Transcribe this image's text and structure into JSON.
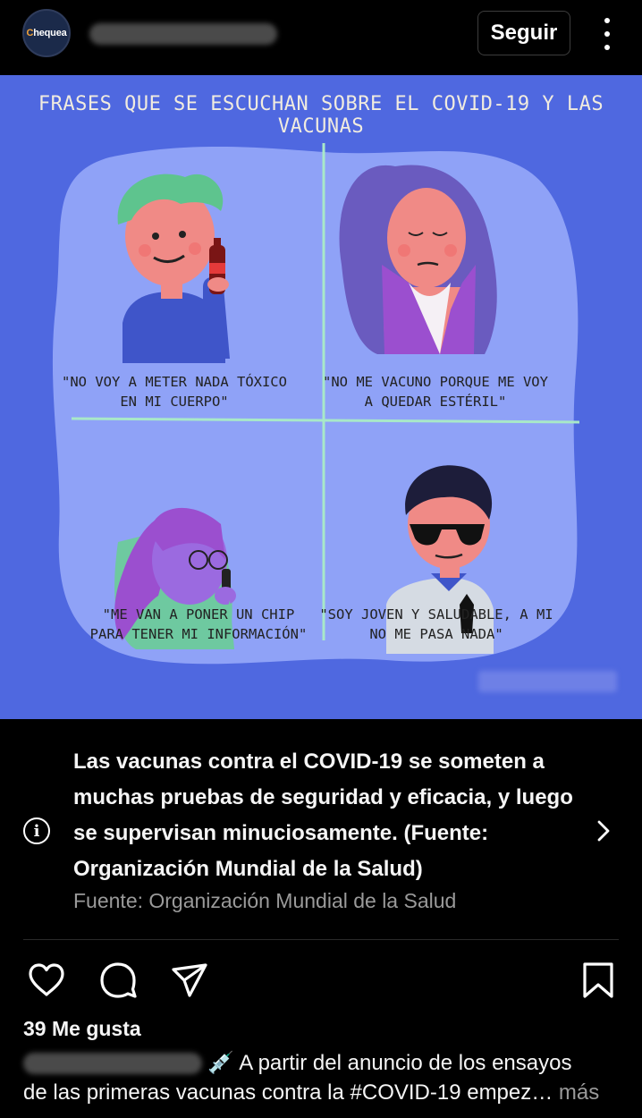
{
  "header": {
    "avatar_logo_prefix": "C",
    "avatar_logo_text": "hequea",
    "follow_label": "Seguir"
  },
  "post": {
    "title": "FRASES QUE SE ESCUCHAN SOBRE EL COVID-19 Y LAS VACUNAS",
    "panels": [
      {
        "quote_line1": "\"NO VOY A METER NADA TÓXICO",
        "quote_line2": "EN MI CUERPO\""
      },
      {
        "quote_line1": "\"NO ME VACUNO PORQUE ME VOY",
        "quote_line2": "A QUEDAR ESTÉRIL\""
      },
      {
        "quote_line1": "\"ME VAN A PONER UN CHIP",
        "quote_line2": "PARA TENER MI INFORMACIÓN\""
      },
      {
        "quote_line1": "\"SOY JOVEN Y SALUDABLE, A MI",
        "quote_line2": "NO ME PASA NADA\""
      }
    ],
    "colors": {
      "background": "#4f68e0",
      "blob": "#8fa2f7",
      "divider": "#a8e8c8"
    }
  },
  "info": {
    "text": "Las vacunas contra el COVID-19 se someten a muchas pruebas de seguridad y eficacia, y luego se supervisan minuciosamente. (Fuente: Organización Mundial de la Salud)",
    "source": "Fuente: Organización Mundial de la Salud"
  },
  "actions": {
    "icons": [
      "heart-icon",
      "comment-icon",
      "share-icon",
      "bookmark-icon"
    ]
  },
  "likes": "39 Me gusta",
  "caption": {
    "line1": "💉 A partir del anuncio de los ensayos",
    "line2": "de las primeras vacunas contra la #COVID-19 empez…",
    "more": " más"
  }
}
